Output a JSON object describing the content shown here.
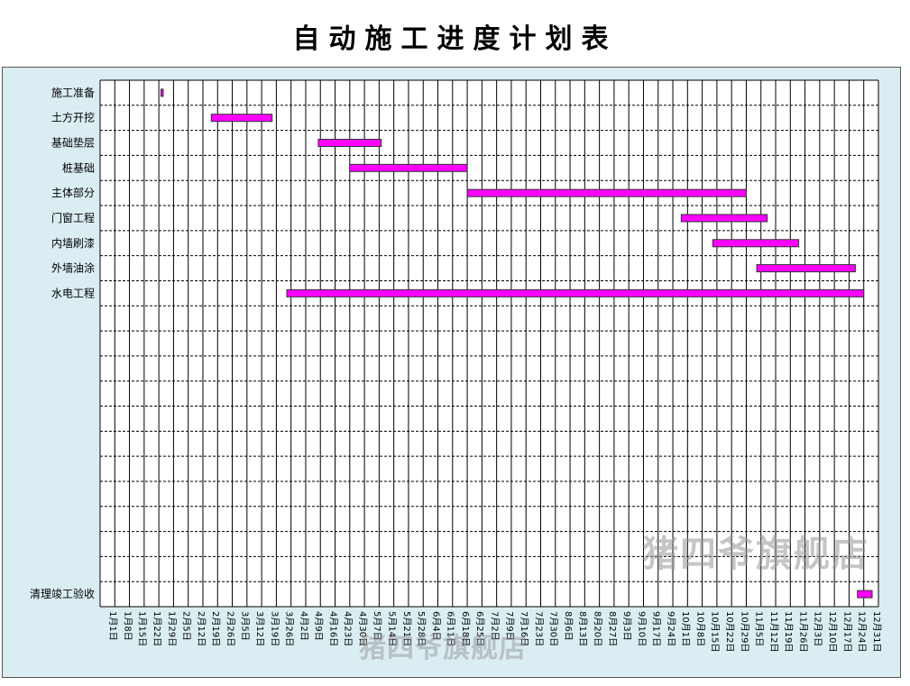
{
  "chart_data": {
    "type": "gantt",
    "title": "自动施工进度计划表",
    "year_ref": "2023",
    "tasks": [
      {
        "name": "施工准备",
        "start": "2023-01-30",
        "end": "2023-01-30"
      },
      {
        "name": "土方开挖",
        "start": "2023-02-23",
        "end": "2023-03-24"
      },
      {
        "name": "基础垫层",
        "start": "2023-04-15",
        "end": "2023-05-15"
      },
      {
        "name": "桩基础",
        "start": "2023-04-30",
        "end": "2023-06-25"
      },
      {
        "name": "主体部分",
        "start": "2023-06-25",
        "end": "2023-11-05"
      },
      {
        "name": "门窗工程",
        "start": "2023-10-05",
        "end": "2023-11-15"
      },
      {
        "name": "内墙刷漆",
        "start": "2023-10-20",
        "end": "2023-11-30"
      },
      {
        "name": "外墙油涂",
        "start": "2023-11-10",
        "end": "2023-12-27"
      },
      {
        "name": "水电工程",
        "start": "2023-03-31",
        "end": "2023-12-31"
      },
      {
        "name": "",
        "start": null,
        "end": null
      },
      {
        "name": "",
        "start": null,
        "end": null
      },
      {
        "name": "",
        "start": null,
        "end": null
      },
      {
        "name": "",
        "start": null,
        "end": null
      },
      {
        "name": "",
        "start": null,
        "end": null
      },
      {
        "name": "",
        "start": null,
        "end": null
      },
      {
        "name": "",
        "start": null,
        "end": null
      },
      {
        "name": "",
        "start": null,
        "end": null
      },
      {
        "name": "",
        "start": null,
        "end": null
      },
      {
        "name": "",
        "start": null,
        "end": null
      },
      {
        "name": "",
        "start": null,
        "end": null
      },
      {
        "name": "清理竣工验收",
        "start": "2023-12-28",
        "end": "2024-01-04"
      }
    ],
    "x_tick_labels": [
      "1月1日",
      "1月8日",
      "1月15日",
      "1月22日",
      "1月29日",
      "2月5日",
      "2月12日",
      "2月19日",
      "2月26日",
      "3月5日",
      "3月12日",
      "3月19日",
      "3月26日",
      "4月2日",
      "4月9日",
      "4月16日",
      "4月23日",
      "4月30日",
      "5月7日",
      "5月14日",
      "5月21日",
      "5月28日",
      "6月4日",
      "6月11日",
      "6月18日",
      "6月25日",
      "7月2日",
      "7月9日",
      "7月16日",
      "7月23日",
      "7月30日",
      "8月6日",
      "8月13日",
      "8月20日",
      "8月27日",
      "9月3日",
      "9月10日",
      "9月17日",
      "9月24日",
      "10月1日",
      "10月8日",
      "10月15日",
      "10月22日",
      "10月29日",
      "11月5日",
      "11月12日",
      "11月19日",
      "11月26日",
      "12月3日",
      "12月10日",
      "12月17日",
      "12月24日",
      "12月31日"
    ],
    "xlim": [
      "2023-01-01",
      "2024-01-07"
    ],
    "grid": true,
    "colors": {
      "bar": "#ff00ff",
      "bar_border": "#333333",
      "plot_bg": "#daedf2",
      "grid": "#000000"
    }
  },
  "watermark": "猪四爷旗舰店"
}
